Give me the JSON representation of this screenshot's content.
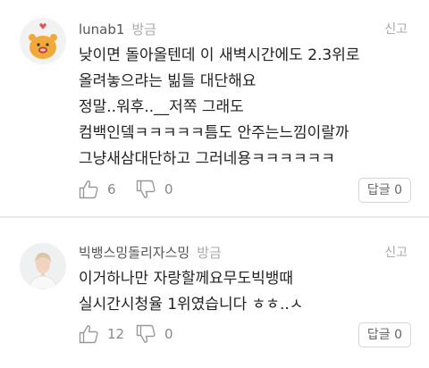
{
  "comments": [
    {
      "username": "lunab1",
      "time": "방금",
      "report_label": "신고",
      "lines": [
        "낮이면 돌아올텐데 이 새벽시간에도 2.3위로",
        "올려놓으랴는 빎들 대단해요",
        "정말..워후..__저쪽 그래도",
        "컴백인뎈ㅋㅋㅋㅋㅋ틈도 안주는느낌이랄까",
        "그냥새삼대단하고 그러네용ㅋㅋㅋㅋㅋㅋ"
      ],
      "likes": "6",
      "dislikes": "0",
      "reply_label": "답글 0",
      "avatar_icon": "kakao-character-avatar"
    },
    {
      "username": "빅뱅스밍돌리자스밍",
      "time": "방금",
      "report_label": "신고",
      "lines": [
        "이거하나만 자랑할께요무도빅뱅때",
        "실시간시청율 1위였습니다 ㅎㅎ..ㅅ"
      ],
      "likes": "12",
      "dislikes": "0",
      "reply_label": "답글 0",
      "avatar_icon": "person-photo-avatar"
    }
  ],
  "colors": {
    "text": "#222222",
    "meta": "#aaaaaa",
    "divider": "#e8e8e8"
  }
}
